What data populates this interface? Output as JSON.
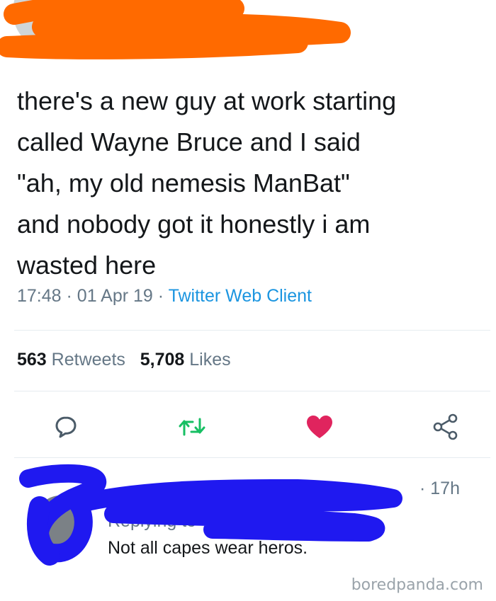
{
  "tweet": {
    "handle_partial": "@",
    "text": "there's a new guy at work starting\ncalled Wayne Bruce and I said\n\"ah, my old nemesis ManBat\"\nand nobody got it honestly i am\nwasted here",
    "time": "17:48",
    "date": "01 Apr 19",
    "separator": "·",
    "client": "Twitter Web Client",
    "retweets_count": "563",
    "retweets_label": "Retweets",
    "likes_count": "5,708",
    "likes_label": "Likes"
  },
  "actions": {
    "reply_icon": "reply-icon",
    "retweet_icon": "retweet-icon",
    "like_icon": "heart-icon",
    "share_icon": "share-icon",
    "colors": {
      "retweet": "#17bf63",
      "like": "#e0245e",
      "gray": "#657786"
    }
  },
  "reply": {
    "time": "· 17h",
    "replying_to": "Replying to",
    "text": "Not all capes wear heros."
  },
  "redactions": {
    "top_color": "#ff6a00",
    "reply_color": "#1f19f0"
  },
  "watermark": "boredpanda.com"
}
